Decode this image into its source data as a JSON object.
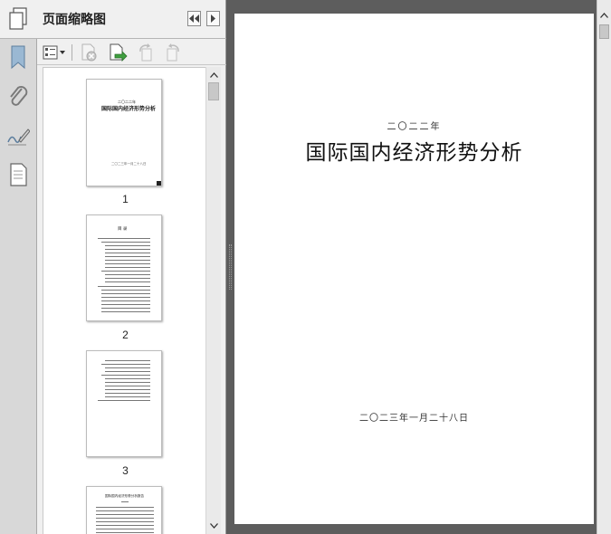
{
  "panel": {
    "title": "页面缩略图"
  },
  "thumbnails": [
    {
      "label": "1",
      "heading": "国际国内经济形势分析",
      "small_top": "二〇二二年",
      "footer": "二〇二三年一月二十八日"
    },
    {
      "label": "2",
      "heading": "目  录"
    },
    {
      "label": "3"
    },
    {
      "label": "",
      "heading": "国际国内经济形势分析报告"
    }
  ],
  "document": {
    "year": "二〇二二年",
    "title": "国际国内经济形势分析",
    "date": "二〇二三年一月二十八日"
  },
  "icons": {
    "rail": [
      "pages-icon",
      "bookmark-icon",
      "attachment-icon",
      "signature-icon",
      "layers-icon"
    ],
    "toolbar": [
      "options-menu-icon",
      "delete-page-icon",
      "extract-page-icon",
      "rotate-left-icon",
      "rotate-right-icon"
    ]
  }
}
